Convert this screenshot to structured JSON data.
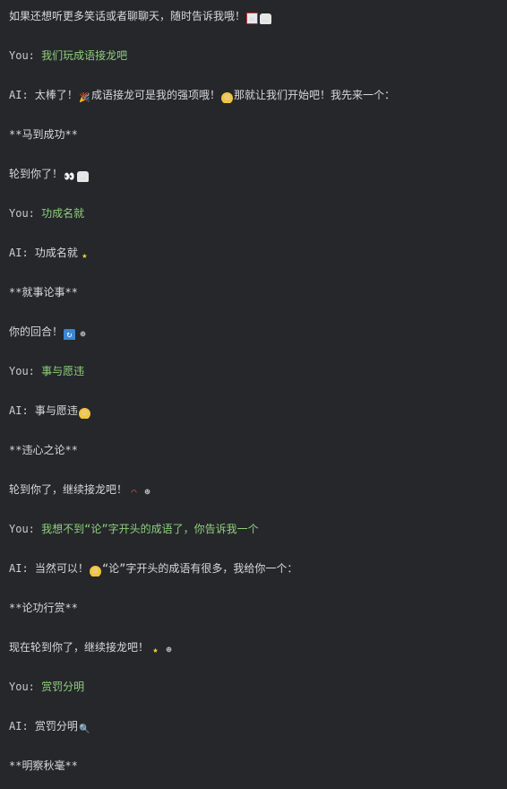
{
  "chat": {
    "lines": [
      {
        "type": "plain",
        "text": "如果还想听更多笑话或者聊聊天，随时告诉我哦！",
        "emojis": [
          "envelope",
          "speech"
        ]
      },
      {
        "type": "you",
        "speaker": "You:",
        "text": "我们玩成语接龙吧",
        "emojis": []
      },
      {
        "type": "ai",
        "speaker": "AI:",
        "text": "太棒了！",
        "emojis": [
          "party"
        ],
        "text2": "成语接龙可是我的强项哦！",
        "emojis2": [
          "grin"
        ],
        "text3": "那就让我们开始吧！我先来一个："
      },
      {
        "type": "plain",
        "text": "**马到成功**",
        "emojis": []
      },
      {
        "type": "plain",
        "text": "轮到你了！",
        "emojis": [
          "eyes",
          "speech"
        ]
      },
      {
        "type": "you",
        "speaker": "You:",
        "text": "功成名就",
        "emojis": []
      },
      {
        "type": "ai",
        "speaker": "AI:",
        "text": "功成名就",
        "emojis": [
          "star"
        ]
      },
      {
        "type": "plain",
        "text": "**就事论事**",
        "emojis": []
      },
      {
        "type": "plain",
        "text": "你的回合！",
        "emojis": [
          "cycle",
          "person"
        ]
      },
      {
        "type": "you",
        "speaker": "You:",
        "text": "事与愿违",
        "emojis": []
      },
      {
        "type": "ai",
        "speaker": "AI:",
        "text": "事与愿违",
        "emojis": [
          "sweat"
        ]
      },
      {
        "type": "plain",
        "text": "**违心之论**",
        "emojis": []
      },
      {
        "type": "plain",
        "text": "轮到你了，继续接龙吧！",
        "emojis": [
          "rainbow",
          "person"
        ]
      },
      {
        "type": "you",
        "speaker": "You:",
        "text": "我想不到“论”字开头的成语了，你告诉我一个",
        "emojis": []
      },
      {
        "type": "ai",
        "speaker": "AI:",
        "text": "当然可以！",
        "emojis": [
          "grin"
        ],
        "text2": "“论”字开头的成语有很多，我给你一个：",
        "emojis2": []
      },
      {
        "type": "plain",
        "text": "**论功行赏**",
        "emojis": []
      },
      {
        "type": "plain",
        "text": "现在轮到你了，继续接龙吧！",
        "emojis": [
          "star",
          "person"
        ]
      },
      {
        "type": "you",
        "speaker": "You:",
        "text": "赏罚分明",
        "emojis": []
      },
      {
        "type": "ai",
        "speaker": "AI:",
        "text": "赏罚分明",
        "emojis": [
          "magnifier"
        ]
      },
      {
        "type": "plain",
        "text": "**明察秋毫**",
        "emojis": []
      }
    ]
  },
  "emoji_glyphs": {
    "envelope": "✉",
    "speech": "…",
    "party": "🎉",
    "grin": "☺",
    "eyes": "👀",
    "star": "★",
    "cycle": "↻",
    "person": "☻",
    "sweat": "☺",
    "rainbow": "◠",
    "magnifier": "🔍"
  }
}
